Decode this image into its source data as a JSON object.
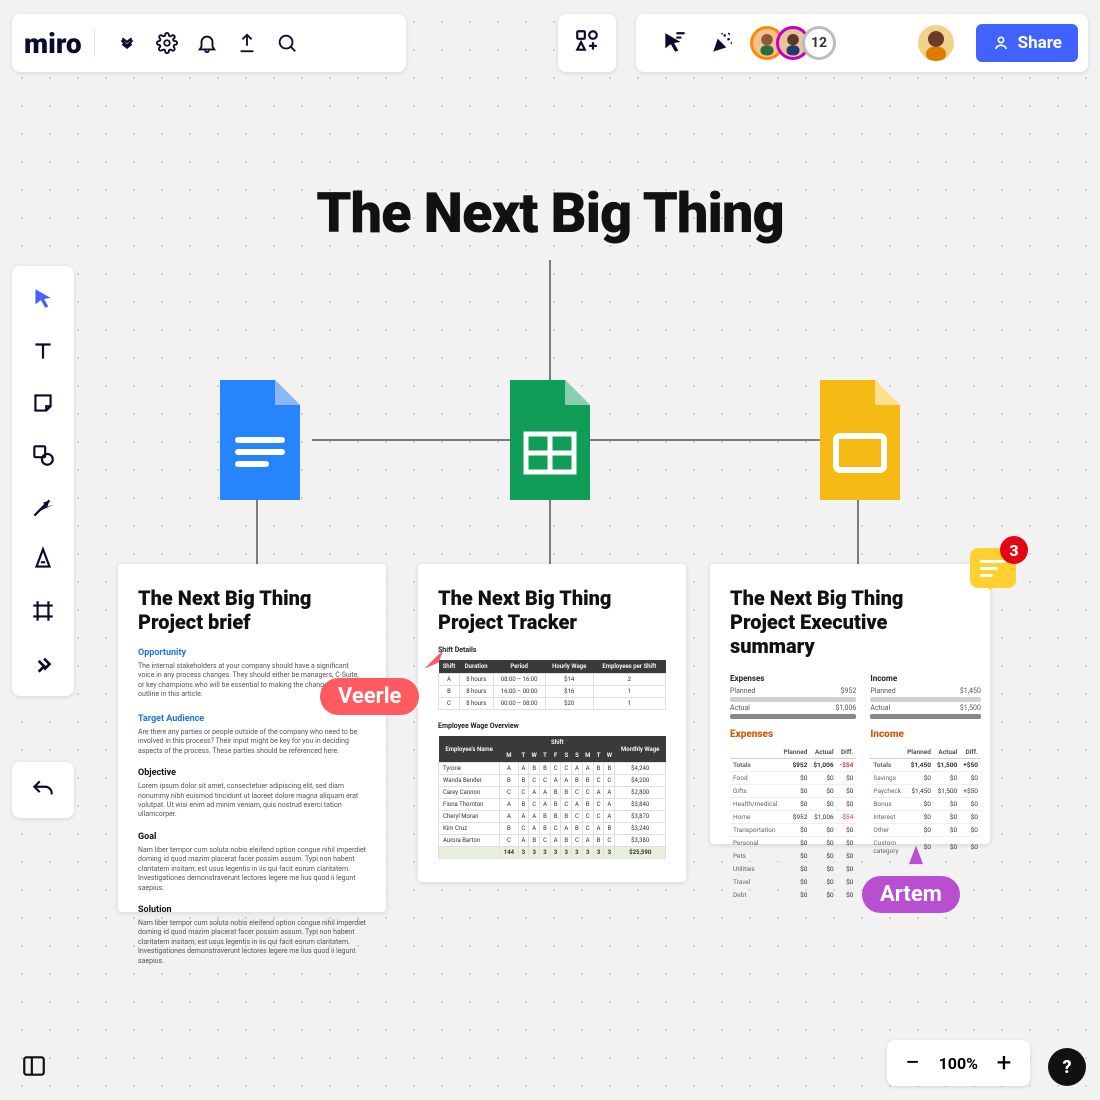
{
  "app": {
    "logo": "miro",
    "share": "Share"
  },
  "presence": {
    "count": "12"
  },
  "board": {
    "title": "The Next Big Thing"
  },
  "zoom": {
    "percent": "100%"
  },
  "comments": {
    "unread": "3"
  },
  "peers": [
    {
      "name": "Veerle",
      "color": "#ff5a5f"
    },
    {
      "name": "Artem",
      "color": "#b84fd1"
    }
  ],
  "cards": {
    "brief": {
      "title": "The Next Big Thing Project brief",
      "sections": {
        "opportunity": {
          "heading": "Opportunity",
          "body": "The internal stakeholders at your company should have a significant voice in any process changes. They should either be managers, C-Suite, or key champions who will be essential to making the changes you outline in this article."
        },
        "audience": {
          "heading": "Target Audience",
          "body": "Are there any parties or people outside of the company who need to be involved in this process? Their input might be key for you in deciding aspects of the process. These parties should be referenced here."
        },
        "objective": {
          "heading": "Objective",
          "body": "Lorem ipsum dolor sit amet, consectetuer adipiscing elit, sed diam nonummy nibh euismod tincidunt ut laoreet dolore magna aliquam erat volutpat. Ut wisi enim ad minim veniam, quis nostrud exerci tation ullamcorper."
        },
        "goal": {
          "heading": "Goal",
          "body": "Nam liber tempor cum soluta nobis eleifend option congue nihil imperdiet doming id quod mazim placerat facer possim assum. Typi non habent claritatem insitam; est usus legentis in iis qui facit eorum claritatem. Investigationes demonstraverunt lectores legere me lius quod ii legunt saepius."
        },
        "solution": {
          "heading": "Solution",
          "body": "Nam liber tempor cum soluta nobis eleifend option congue nihil imperdiet doming id quod mazim placerat facer possim assum. Typi non habent claritatem insitam; est usus legentis in iis qui facit eorum claritatem. Investigationes demonstraverunt lectores legere me lius quod ii legunt saepius."
        }
      }
    },
    "tracker": {
      "title": "The Next Big Thing Project Tracker",
      "shift_heading": "Shift Details",
      "shift_table": {
        "headers": [
          "Shift",
          "Duration",
          "Period",
          "Hourly Wage",
          "Employees per Shift"
        ],
        "rows": [
          [
            "A",
            "8 hours",
            "08:00 – 16:00",
            "$14",
            "2"
          ],
          [
            "B",
            "8 hours",
            "16:00 – 00:00",
            "$16",
            "1"
          ],
          [
            "C",
            "8 hours",
            "00:00 – 08:00",
            "$20",
            "1"
          ]
        ]
      },
      "wage_heading": "Employee Wage Overview",
      "wage_table": {
        "headers": [
          "Employee's Name",
          "Shift",
          "Monthly Wage"
        ],
        "days": [
          "M",
          "T",
          "W",
          "T",
          "F",
          "S",
          "S",
          "M",
          "T",
          "W"
        ],
        "rows": [
          {
            "name": "Tyrone",
            "cells": [
              "A",
              "A",
              "B",
              "B",
              "C",
              "C",
              "A",
              "A",
              "B",
              "B"
            ],
            "wage": "$4,240"
          },
          {
            "name": "Wanda Bender",
            "cells": [
              "B",
              "B",
              "C",
              "C",
              "A",
              "A",
              "B",
              "B",
              "C",
              "C"
            ],
            "wage": "$4,200"
          },
          {
            "name": "Carey Cannon",
            "cells": [
              "C",
              "C",
              "A",
              "A",
              "B",
              "B",
              "C",
              "C",
              "A",
              "A"
            ],
            "wage": "$2,800"
          },
          {
            "name": "Fiona Thornton",
            "cells": [
              "A",
              "B",
              "C",
              "A",
              "B",
              "C",
              "A",
              "B",
              "C",
              "A"
            ],
            "wage": "$3,840"
          },
          {
            "name": "Cheryl Moran",
            "cells": [
              "A",
              "A",
              "A",
              "B",
              "B",
              "B",
              "C",
              "C",
              "C",
              "A"
            ],
            "wage": "$3,870"
          },
          {
            "name": "Kim Cruz",
            "cells": [
              "B",
              "C",
              "A",
              "B",
              "C",
              "A",
              "B",
              "C",
              "A",
              "B"
            ],
            "wage": "$3,240"
          },
          {
            "name": "Aurora Barton",
            "cells": [
              "C",
              "A",
              "B",
              "C",
              "A",
              "B",
              "C",
              "A",
              "B",
              "C"
            ],
            "wage": "$3,380"
          }
        ],
        "total": {
          "label": "",
          "cells": [
            "144",
            "3",
            "3",
            "3",
            "3",
            "3",
            "3",
            "3",
            "3",
            "3"
          ],
          "wage": "$25,590"
        }
      }
    },
    "exec": {
      "title": "The Next Big Thing Project Executive summary",
      "summary": {
        "expenses": {
          "label": "Expenses",
          "planned": "$952",
          "actual": "$1,006"
        },
        "income": {
          "label": "Income",
          "planned": "$1,450",
          "actual": "$1,500"
        }
      },
      "expense_table": {
        "heading": "Expenses",
        "headers": [
          "",
          "Planned",
          "Actual",
          "Diff."
        ],
        "total": [
          "Totals",
          "$952",
          "$1,006",
          "-$54"
        ],
        "rows": [
          [
            "Food",
            "$0",
            "$0",
            "$0"
          ],
          [
            "Gifts",
            "$0",
            "$0",
            "$0"
          ],
          [
            "Health/medical",
            "$0",
            "$0",
            "$0"
          ],
          [
            "Home",
            "$952",
            "$1,006",
            "-$54"
          ],
          [
            "Transportation",
            "$0",
            "$0",
            "$0"
          ],
          [
            "Personal",
            "$0",
            "$0",
            "$0"
          ],
          [
            "Pets",
            "$0",
            "$0",
            "$0"
          ],
          [
            "Utilities",
            "$0",
            "$0",
            "$0"
          ],
          [
            "Travel",
            "$0",
            "$0",
            "$0"
          ],
          [
            "Debt",
            "$0",
            "$0",
            "$0"
          ]
        ]
      },
      "income_table": {
        "heading": "Income",
        "headers": [
          "",
          "Planned",
          "Actual",
          "Diff."
        ],
        "total": [
          "Totals",
          "$1,450",
          "$1,500",
          "+$50"
        ],
        "rows": [
          [
            "Savings",
            "$0",
            "$0",
            "$0"
          ],
          [
            "Paycheck",
            "$1,450",
            "$1,500",
            "+$50"
          ],
          [
            "Bonus",
            "$0",
            "$0",
            "$0"
          ],
          [
            "Interest",
            "$0",
            "$0",
            "$0"
          ],
          [
            "Other",
            "$0",
            "$0",
            "$0"
          ],
          [
            "Custom category",
            "$0",
            "$0",
            "$0"
          ]
        ]
      },
      "row_labels": {
        "planned": "Planned",
        "actual": "Actual"
      }
    }
  }
}
